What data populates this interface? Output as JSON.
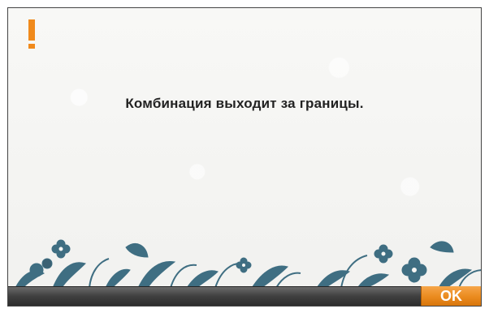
{
  "dialog": {
    "message": "Комбинация выходит за границы.",
    "icon": "exclamation-icon",
    "accent_color": "#f08a1c"
  },
  "footer": {
    "ok_label": "OK"
  }
}
